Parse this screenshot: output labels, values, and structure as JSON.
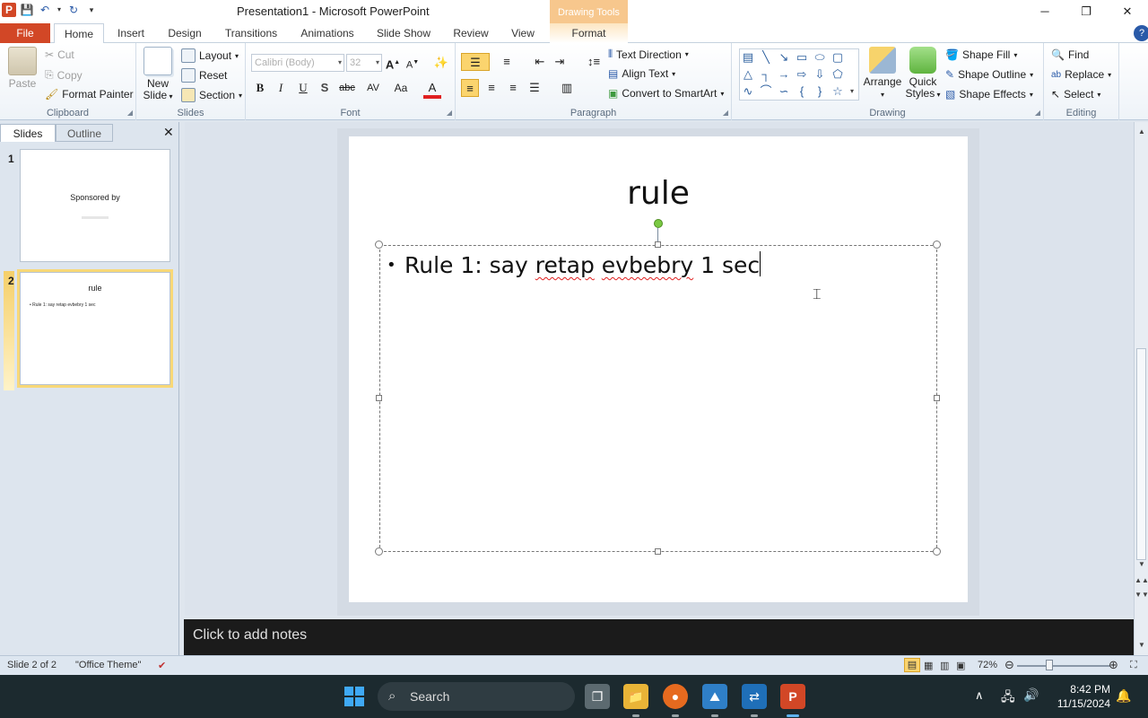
{
  "window": {
    "title": "Presentation1 - Microsoft PowerPoint",
    "context_tab_title": "Drawing Tools",
    "controls": [
      "minimize-icon",
      "restore-icon",
      "close-icon"
    ]
  },
  "tabs": [
    "File",
    "Home",
    "Insert",
    "Design",
    "Transitions",
    "Animations",
    "Slide Show",
    "Review",
    "View",
    "Format"
  ],
  "ribbon": {
    "clipboard": {
      "label": "Clipboard",
      "paste": "Paste",
      "cut": "Cut",
      "copy": "Copy",
      "format_painter": "Format Painter"
    },
    "slides": {
      "label": "Slides",
      "new_slide": "New",
      "new_slide2": "Slide",
      "layout": "Layout",
      "reset": "Reset",
      "section": "Section"
    },
    "font": {
      "label": "Font",
      "font_name": "Calibri (Body)",
      "font_size": "32",
      "bold": "B",
      "italic": "I",
      "underline": "U",
      "shadow": "S",
      "strike": "abc",
      "spacing": "AV",
      "case": "Aa",
      "color": "A"
    },
    "paragraph": {
      "label": "Paragraph",
      "text_direction": "Text Direction",
      "align_text": "Align Text",
      "smartart": "Convert to SmartArt"
    },
    "drawing": {
      "label": "Drawing",
      "arrange": "Arrange",
      "quick_styles": "Quick",
      "quick_styles2": "Styles",
      "shape_fill": "Shape Fill",
      "shape_outline": "Shape Outline",
      "shape_effects": "Shape Effects"
    },
    "editing": {
      "label": "Editing",
      "find": "Find",
      "replace": "Replace",
      "select": "Select"
    }
  },
  "left_pane": {
    "tab_slides": "Slides",
    "tab_outline": "Outline",
    "thumbnails": [
      {
        "num": "1",
        "title": "Sponsored by",
        "sub": ""
      },
      {
        "num": "2",
        "title": "rule",
        "sub": "Rule 1: say retap evbebry 1 sec"
      }
    ]
  },
  "slide": {
    "title": "rule",
    "bullet_prefix": "Rule 1: say ",
    "word_retap": "retap",
    "word_evbebry": "evbebry",
    "bullet_suffix": " 1 sec"
  },
  "notes": {
    "placeholder": "Click to add notes"
  },
  "status": {
    "slide_info": "Slide 2 of 2",
    "theme": "\"Office Theme\"",
    "zoom": "72%",
    "zoom_level_percent": 72
  },
  "taskbar": {
    "search_placeholder": "Search",
    "time": "8:42 PM",
    "date": "11/15/2024"
  },
  "colors": {
    "file_tab": "#d24726",
    "context_tab": "#f7c78d",
    "rotation_handle": "#7ac943",
    "taskbar": "#1c2a2f"
  }
}
